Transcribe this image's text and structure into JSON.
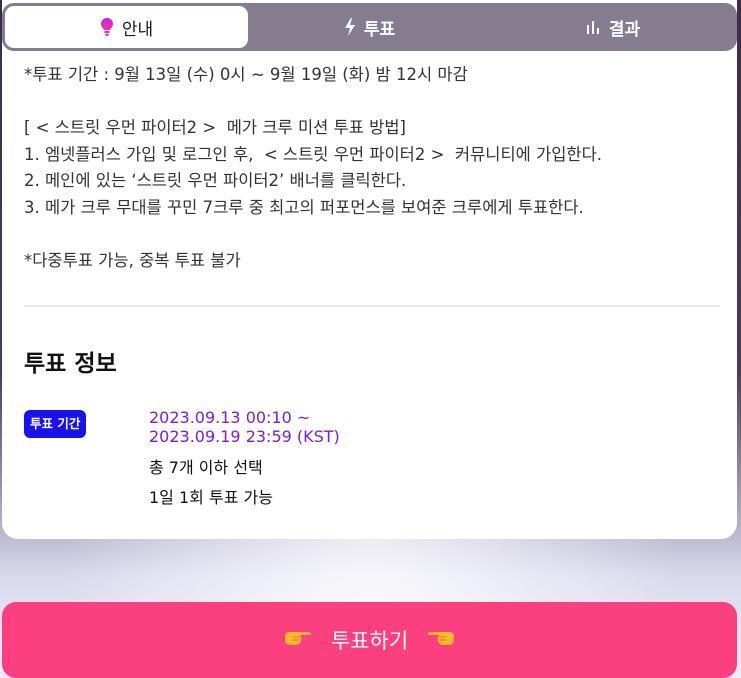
{
  "tabs": [
    {
      "label": "안내",
      "icon": "lightbulb-icon",
      "active": true
    },
    {
      "label": "투표",
      "icon": "lightning-icon",
      "active": false
    },
    {
      "label": "결과",
      "icon": "bar-chart-icon",
      "active": false
    }
  ],
  "guide": {
    "lines": [
      "*투표 기간 : 9월 13일 (수) 0시 ~ 9월 19일 (화) 밤 12시 마감",
      "",
      "[ < 스트릿 우먼 파이터2 >  메가 크루 미션 투표 방법]",
      "1. 엠넷플러스 가입 및 로그인 후,  < 스트릿 우먼 파이터2 >  커뮤니티에 가입한다.",
      "2. 메인에 있는 ‘스트릿 우먼 파이터2’ 배너를 클릭한다.",
      "3. 메가 크루 무대를 꾸민 7크루 중 최고의 퍼포먼스를 보여준 크루에게 투표한다.",
      "",
      "*다중투표 가능, 중복 투표 불가"
    ]
  },
  "vote_info": {
    "title": "투표 정보",
    "badge": "투표 기간",
    "period_line1": "2023.09.13 00:10 ~",
    "period_line2": "2023.09.19 23:59 (KST)",
    "selection_limit": "총 7개 이하 선택",
    "frequency": "1일 1회 투표 가능"
  },
  "vote_button": {
    "label": "투표하기",
    "left_icon": "pointing-hand-right-icon",
    "right_icon": "pointing-hand-left-icon"
  },
  "colors": {
    "accent_pink": "#fc3f7e",
    "badge_blue": "#1a12ee",
    "period_purple": "#7d1bd6",
    "tab_bar": "#857c8f"
  }
}
